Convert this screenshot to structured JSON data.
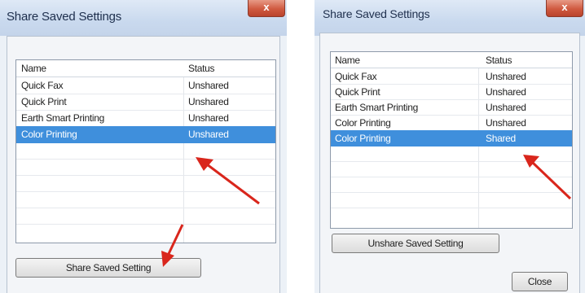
{
  "left_dialog": {
    "title": "Share Saved Settings",
    "close_glyph": "x",
    "columns": {
      "name": "Name",
      "status": "Status"
    },
    "rows": [
      {
        "name": "Quick Fax",
        "status": "Unshared"
      },
      {
        "name": "Quick Print",
        "status": "Unshared"
      },
      {
        "name": "Earth Smart Printing",
        "status": "Unshared"
      },
      {
        "name": "Color Printing",
        "status": "Unshared",
        "selected": true
      }
    ],
    "share_button": "Share Saved Setting"
  },
  "right_dialog": {
    "title": "Share Saved Settings",
    "close_glyph": "x",
    "columns": {
      "name": "Name",
      "status": "Status"
    },
    "rows": [
      {
        "name": "Quick Fax",
        "status": "Unshared"
      },
      {
        "name": "Quick Print",
        "status": "Unshared"
      },
      {
        "name": "Earth Smart Printing",
        "status": "Unshared"
      },
      {
        "name": "Color Printing",
        "status": "Unshared"
      },
      {
        "name": "Color Printing",
        "status": "Shared",
        "selected": true
      }
    ],
    "unshare_button": "Unshare Saved Setting",
    "close_button": "Close"
  },
  "colors": {
    "selection": "#3f8fdc",
    "annotation_arrow": "#d9261c",
    "close_button": "#d05a40"
  }
}
